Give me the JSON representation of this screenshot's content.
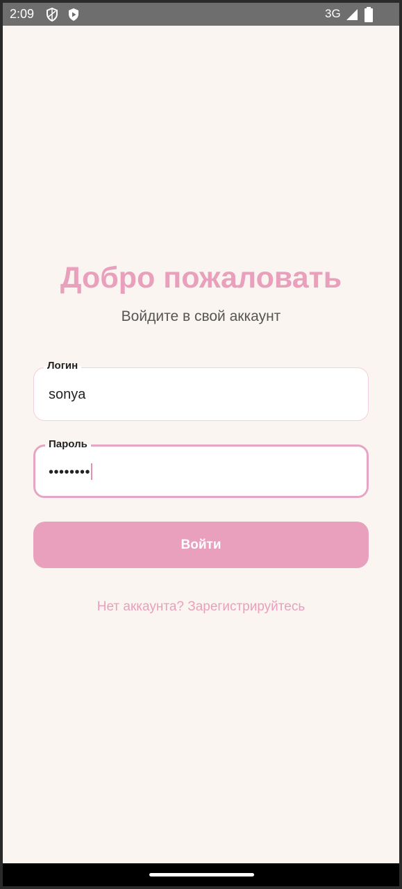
{
  "status_bar": {
    "time": "2:09",
    "network": "3G",
    "icons": [
      "shield-icon",
      "play-protect-icon",
      "signal-icon",
      "battery-icon"
    ]
  },
  "login_screen": {
    "title": "Добро пожаловать",
    "subtitle": "Войдите в свой аккаунт",
    "login_field": {
      "label": "Логин",
      "value": "sonya"
    },
    "password_field": {
      "label": "Пароль",
      "value": "••••••••"
    },
    "submit_label": "Войти",
    "register_link": "Нет аккаунта? Зарегистрируйтесь"
  },
  "colors": {
    "accent": "#e8a0bd",
    "background": "#faf5f0",
    "focused_border": "#e6a6c3",
    "idle_border": "#f2cfe0"
  }
}
